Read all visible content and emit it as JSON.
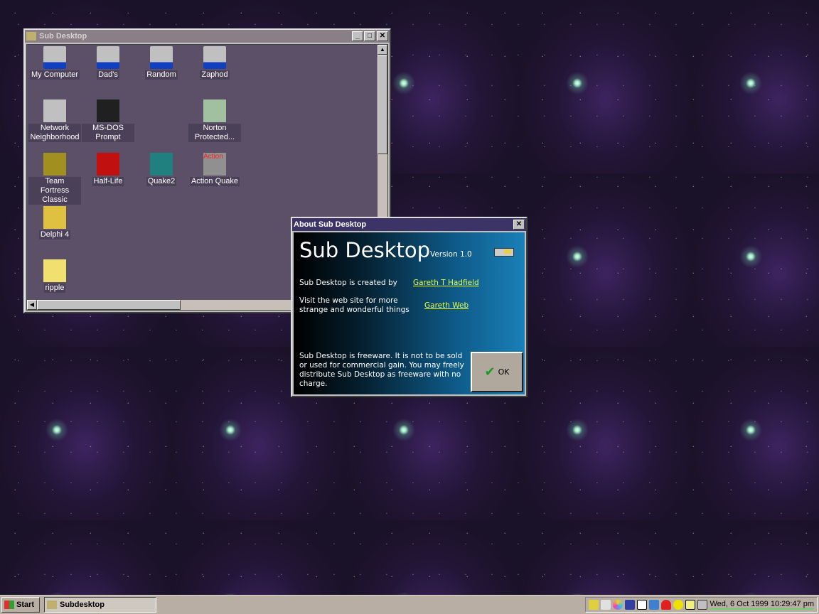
{
  "sub_window": {
    "title": "Sub Desktop",
    "icons": [
      {
        "label": "My Computer",
        "icon": "computer-icon"
      },
      {
        "label": "Dad's",
        "icon": "computer-shortcut-icon"
      },
      {
        "label": "Random",
        "icon": "computer-shortcut-icon"
      },
      {
        "label": "Zaphod",
        "icon": "computer-shortcut-icon"
      },
      {
        "label": "Network Neighborhood",
        "icon": "network-icon"
      },
      {
        "label": "MS-DOS Prompt",
        "icon": "msdos-icon"
      },
      {
        "label": "Norton Protected...",
        "icon": "recycle-bin-icon"
      },
      {
        "label": "Team Fortress Classic",
        "icon": "tfc-icon"
      },
      {
        "label": "Half-Life",
        "icon": "half-life-icon"
      },
      {
        "label": "Quake2",
        "icon": "quake2-icon"
      },
      {
        "label": "Action Quake",
        "icon": "action-quake-icon",
        "overlay": "Action"
      },
      {
        "label": "Delphi 4",
        "icon": "delphi-icon"
      },
      {
        "label": "ripple",
        "icon": "folder-icon"
      }
    ]
  },
  "about": {
    "title": "About Sub Desktop",
    "app_name": "Sub Desktop",
    "version": "Version 1.0",
    "created_by": "Sub Desktop is created by",
    "author_link": "Gareth T Hadfield",
    "visit_text": "Visit the web site for more strange and wonderful things",
    "web_link": "Gareth Web",
    "freeware_text": "Sub Desktop is freeware. It is not to be sold or used for commercial gain. You may freely distribute Sub Desktop as freeware with no charge.",
    "ok": "OK"
  },
  "taskbar": {
    "start": "Start",
    "task": "Subdesktop",
    "clock": "Wed, 6 Oct 1999  10:29:47 pm"
  }
}
